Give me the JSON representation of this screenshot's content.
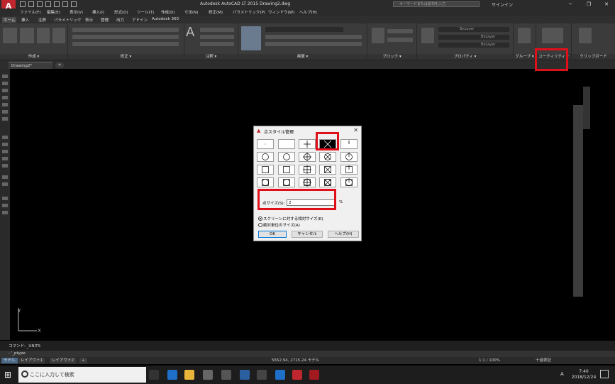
{
  "titlebar": {
    "app_letter": "A",
    "title": "Autodesk AutoCAD LT 2015   Drawing2.dwg",
    "search_placeholder": "キーワードまたは語句を入力",
    "signin": "サインイン",
    "minimize": "─",
    "restore": "❐",
    "close": "✕"
  },
  "menubar": {
    "items": [
      "ファイル(F)",
      "編集(E)",
      "表示(V)",
      "挿入(I)",
      "形式(O)",
      "ツール(T)",
      "作成(D)",
      "寸法(N)",
      "修正(M)",
      "パラメトリック(P)",
      "ウィンドウ(W)",
      "ヘルプ(H)"
    ]
  },
  "ribbon_tabs": [
    "ホーム",
    "挿入",
    "注釈",
    "パラメトリック",
    "表示",
    "管理",
    "出力",
    "アドイン",
    "Autodesk 360"
  ],
  "ribbon_panels": {
    "draw": "作成 ▾",
    "modify": "修正 ▾",
    "annotation": "注釈 ▾",
    "layers": "画層 ▾",
    "block": "ブロック ▾",
    "properties": "プロパティ ▾",
    "groups": "グループ ▾",
    "utilities": "ユーティリティ ▾",
    "clipboard": "クリップボード"
  },
  "ribbon_props": {
    "bylayer1": "ByLayer",
    "bylayer2": "ByLayer",
    "bylayer3": "ByLayer"
  },
  "file_tab": {
    "label": "Drawing2*",
    "new_tab": "+"
  },
  "dialog": {
    "title": "点スタイル管理",
    "size_label": "点サイズ(S):",
    "size_value": "2",
    "size_unit": "%",
    "radio_relative": "スクリーンに対する相対サイズ(R)",
    "radio_absolute": "絶対単位のサイズ(A)",
    "ok": "OK",
    "cancel": "キャンセル",
    "help": "ヘルプ(H)"
  },
  "command": {
    "history": "コマンド: _UNITS",
    "prompt": "- '_ptype"
  },
  "layout_tabs": [
    "モデル",
    "レイアウト1",
    "レイアウト2",
    "+"
  ],
  "status": {
    "coords": "5652.94, 2715.24  モデル",
    "scale": "1:1 / 100%",
    "decimal": "十進表記"
  },
  "taskbar": {
    "search": "ここに入力して検索",
    "time": "7:40",
    "date": "2018/12/24",
    "ime": "A"
  },
  "colors": {
    "highlight": "#e0101a",
    "accent": "#c0262d",
    "canvas": "#000000"
  }
}
